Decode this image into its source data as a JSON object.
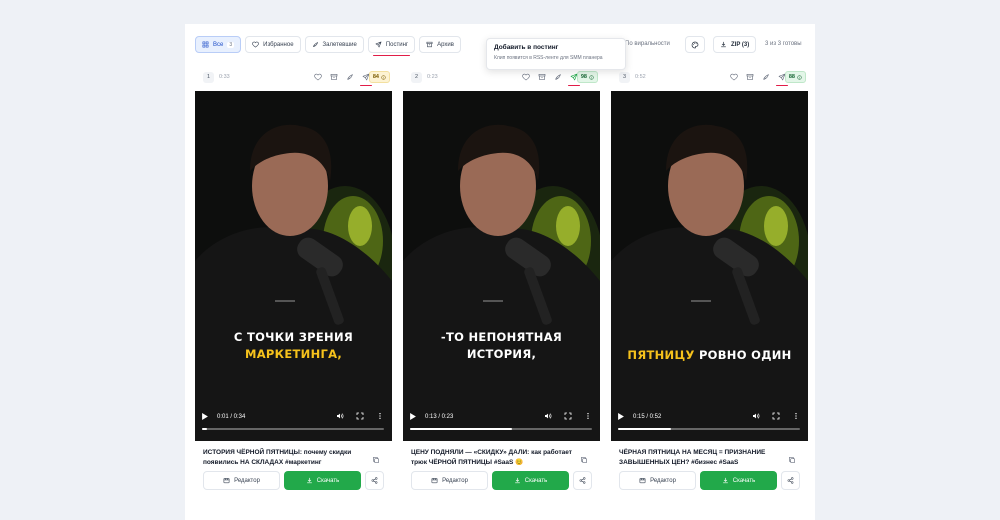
{
  "filters": [
    {
      "label": "Все",
      "count": "3",
      "icon": "grid-icon",
      "active": true
    },
    {
      "label": "Избранное",
      "icon": "heart-icon"
    },
    {
      "label": "Залетевшие",
      "icon": "rocket-icon"
    },
    {
      "label": "Постинг",
      "icon": "send-icon",
      "underline": true
    },
    {
      "label": "Архив",
      "icon": "archive-icon"
    }
  ],
  "sort_label": "По виральности",
  "zip_label": "ZIP (3)",
  "ready_status": "3 из 3 готовы",
  "tooltip": {
    "title": "Добавить в постинг",
    "text": "Клип появится в RSS-ленте для SMM планера"
  },
  "cards": [
    {
      "index": "1",
      "duration": "0:33",
      "score": "84",
      "score_tone": "yellow",
      "caption_white": "С ТОЧКИ ЗРЕНИЯ",
      "caption_yellow": "МАРКЕТИНГА,",
      "player_time": "0:01 / 0:34",
      "progress": 0.03,
      "title": "ИСТОРИЯ ЧЁРНОЙ ПЯТНИЦЫ: почему скидки появились НА СКЛАДАХ #маркетинг"
    },
    {
      "index": "2",
      "duration": "0:23",
      "score": "98",
      "score_tone": "green",
      "caption_white": "-ТО НЕПОНЯТНАЯ",
      "caption_white2": "ИСТОРИЯ,",
      "player_time": "0:13 / 0:23",
      "progress": 0.56,
      "title": "ЦЕНУ ПОДНЯЛИ — «СКИДКУ» ДАЛИ: как работает трюк ЧЁРНОЙ ПЯТНИЦЫ #SaaS 😊"
    },
    {
      "index": "3",
      "duration": "0:52",
      "score": "88",
      "score_tone": "green",
      "caption_yellow": "ПЯТНИЦУ",
      "caption_white": "РОВНО ОДИН",
      "player_time": "0:15 / 0:52",
      "progress": 0.29,
      "title": "ЧЁРНАЯ ПЯТНИЦА НА МЕСЯЦ = ПРИЗНАНИЕ ЗАВЫШЕННЫХ ЦЕН? #бизнес #SaaS"
    }
  ],
  "buttons": {
    "edit": "Редактор",
    "download": "Скачать"
  },
  "colors": {
    "accent_blue": "#1e4ec8",
    "download_green": "#22a94a",
    "highlight_yellow": "#f6c21c",
    "underline_red": "#e11d48"
  }
}
